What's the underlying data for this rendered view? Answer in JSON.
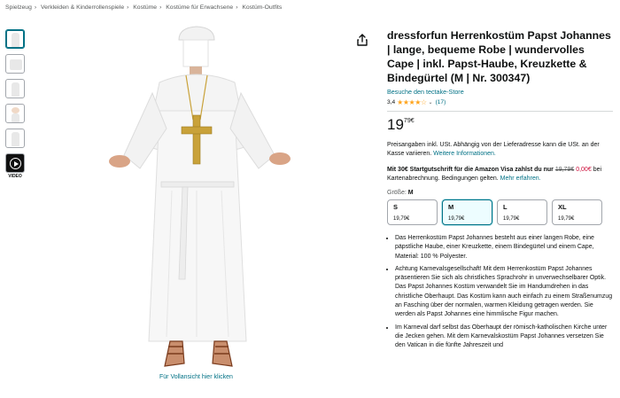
{
  "breadcrumb": [
    "Spielzeug",
    "Verkleiden & Kinderrollenspiele",
    "Kostüme",
    "Kostüme für Erwachsene",
    "Kostüm-Outfits"
  ],
  "breadcrumb_sep": "›",
  "thumbnails": {
    "video_label": "VIDEO"
  },
  "gallery": {
    "view_full_label": "Für Vollansicht hier klicken"
  },
  "product": {
    "title": "dressforfun Herrenkostüm Papst Johannes | lange, bequeme Robe | wundervolles Cape | inkl. Papst-Haube, Kreuzkette & Bindegürtel (M | Nr. 300347)",
    "store_link": "Besuche den tectake-Store",
    "rating_value": "3,4",
    "rating_stars": 3.4,
    "stars_text": "★★★★☆",
    "rating_count": "(17)",
    "price_whole": "19",
    "price_fraction": "79",
    "price_currency": "€",
    "vat_text": "Preisangaben inkl. USt. Abhängig von der Lieferadresse kann die USt. an der Kasse variieren.",
    "vat_link": "Weitere Informationen.",
    "promo_bold": "Mit 30€ Startgutschrift für die Amazon Visa zahlst du nur",
    "promo_old_price": "19,79€",
    "promo_new_price": "0,00€",
    "promo_text": "bei Kartenabrechnung. Bedingungen gelten.",
    "promo_link": "Mehr erfahren.",
    "size_label": "Größe:",
    "size_selected": "M",
    "sizes": [
      {
        "label": "S",
        "price": "19,79€"
      },
      {
        "label": "M",
        "price": "19,79€"
      },
      {
        "label": "L",
        "price": "19,79€"
      },
      {
        "label": "XL",
        "price": "19,79€"
      }
    ],
    "bullets": [
      "Das Herrenkostüm Papst Johannes besteht aus einer langen Robe, eine päpstliche Haube, einer Kreuzkette, einem Bindegürtel und einem Cape, Material: 100 % Polyester.",
      "Achtung Karnevalsgesellschaft! Mit dem Herrenkostüm Papst Johannes präsentieren Sie sich als christliches Sprachrohr in unverwechselbarer Optik. Das Papst Johannes Kostüm verwandelt Sie im Handumdrehen in das christliche Oberhaupt. Das Kostüm kann auch einfach zu einem Straßenumzug an Fasching über der normalen, warmen Kleidung getragen werden. Sie werden als Papst Johannes eine himmlische Figur machen.",
      "Im Karneval darf selbst das Oberhaupt der römisch-katholischen Kirche unter die Jecken gehen. Mit dem Karnevalskostüm Papst Johannes versetzen Sie den Vatican in die fünfte Jahreszeit und"
    ]
  },
  "colors": {
    "link": "#007185",
    "star": "#ffa41c",
    "deal_red": "#cc0c39",
    "selected_border": "#007185"
  },
  "icons": {
    "share": "share-icon",
    "play": "play-icon"
  }
}
